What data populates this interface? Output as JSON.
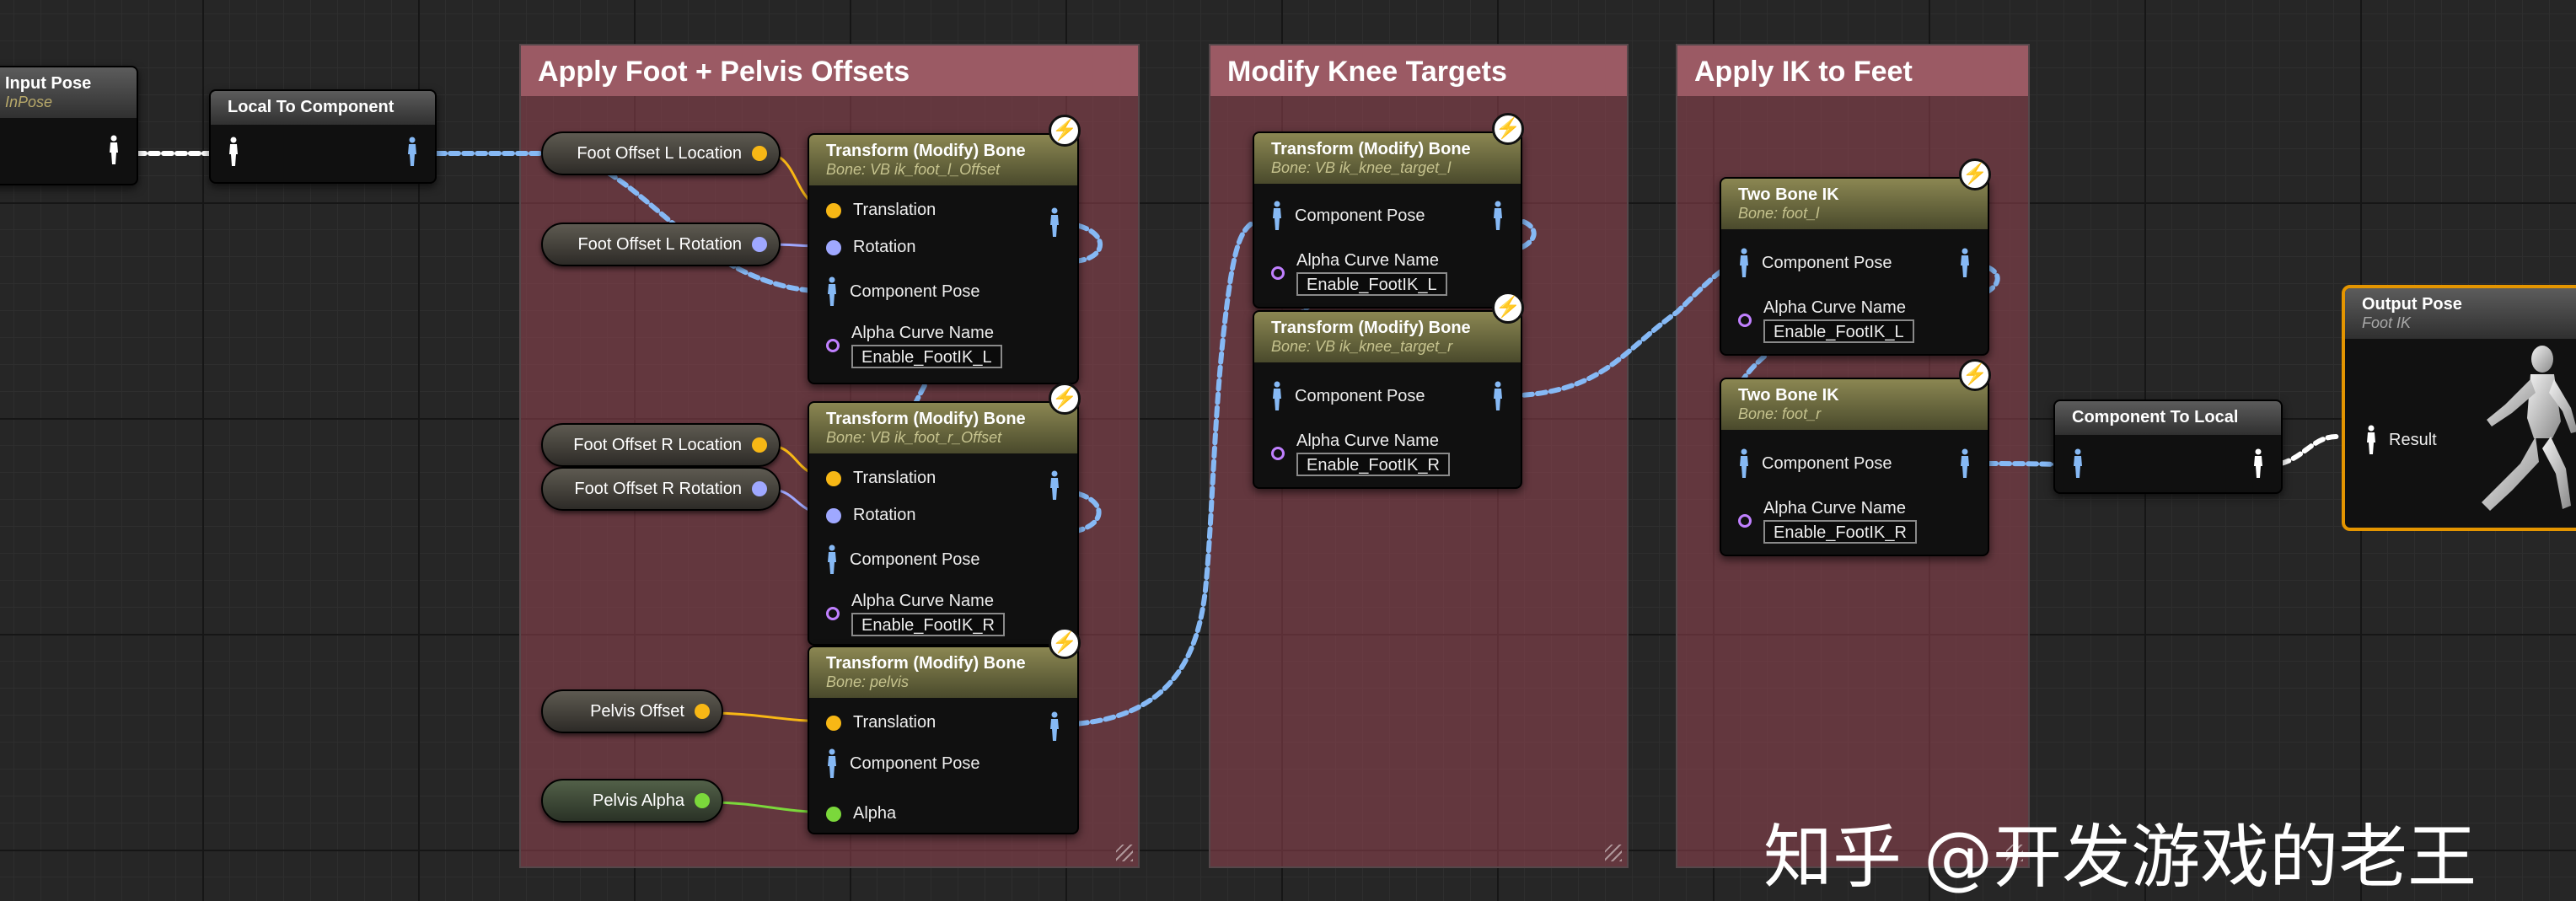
{
  "comments": {
    "apply_offsets": "Apply Foot + Pelvis Offsets",
    "modify_knee": "Modify Knee Targets",
    "apply_ik": "Apply IK to Feet"
  },
  "input_pose": {
    "title": "Input Pose",
    "subtitle": "InPose"
  },
  "local_to_component": {
    "title": "Local To Component"
  },
  "component_to_local": {
    "title": "Component To Local"
  },
  "output_pose": {
    "title": "Output Pose",
    "subtitle": "Foot IK",
    "pin": "Result"
  },
  "variables": {
    "foot_l_loc": "Foot Offset L Location",
    "foot_l_rot": "Foot Offset L Rotation",
    "foot_r_loc": "Foot Offset R Location",
    "foot_r_rot": "Foot Offset R Rotation",
    "pelvis_offset": "Pelvis Offset",
    "pelvis_alpha": "Pelvis Alpha"
  },
  "pins": {
    "translation": "Translation",
    "rotation": "Rotation",
    "component_pose": "Component Pose",
    "alpha_curve_name": "Alpha Curve Name",
    "alpha": "Alpha"
  },
  "transform_nodes": [
    {
      "title": "Transform (Modify) Bone",
      "bone": "Bone: VB ik_foot_l_Offset",
      "curve": "Enable_FootIK_L"
    },
    {
      "title": "Transform (Modify) Bone",
      "bone": "Bone: VB ik_foot_r_Offset",
      "curve": "Enable_FootIK_R"
    },
    {
      "title": "Transform (Modify) Bone",
      "bone": "Bone: pelvis"
    },
    {
      "title": "Transform (Modify) Bone",
      "bone": "Bone: VB ik_knee_target_l",
      "curve": "Enable_FootIK_L"
    },
    {
      "title": "Transform (Modify) Bone",
      "bone": "Bone: VB ik_knee_target_r",
      "curve": "Enable_FootIK_R"
    }
  ],
  "two_bone_nodes": [
    {
      "title": "Two Bone IK",
      "bone": "Bone: foot_l",
      "curve": "Enable_FootIK_L"
    },
    {
      "title": "Two Bone IK",
      "bone": "Bone: foot_r",
      "curve": "Enable_FootIK_R"
    }
  ],
  "watermark": "知乎 @开发游戏的老王",
  "colors": {
    "exec_wire": "#86b9f5",
    "vector_pin": "#f7b715",
    "rotator_pin": "#9fa8ff",
    "float_pin": "#7bd83b",
    "name_pin": "#c080ff",
    "output_border": "#e49500",
    "comment_header": "#9b5a64"
  },
  "icons": [
    "pose-figure-icon",
    "lightning-bolt-icon",
    "mannequin-icon"
  ]
}
